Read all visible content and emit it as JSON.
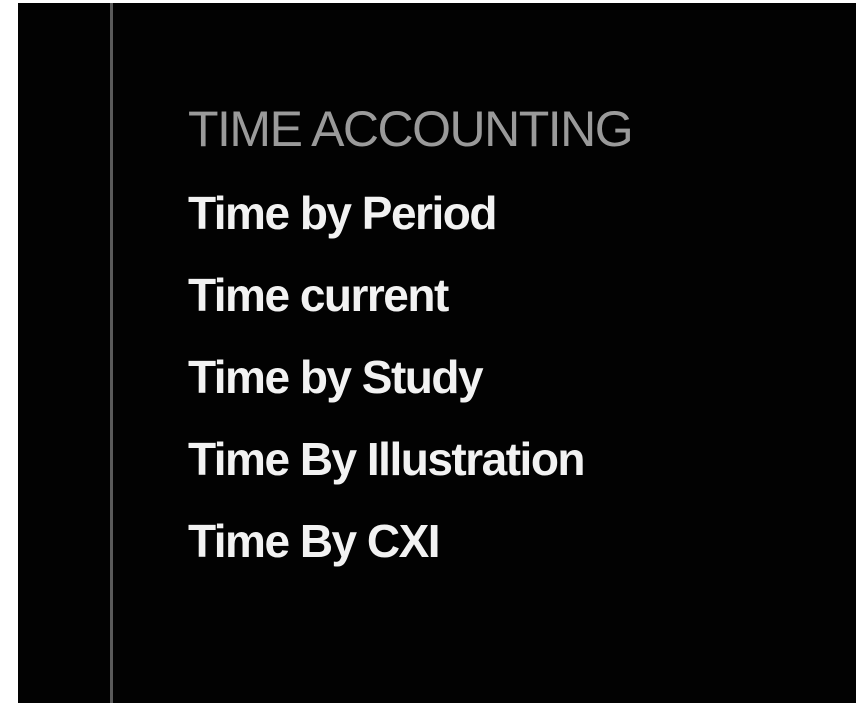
{
  "section": {
    "title": "TIME ACCOUNTING",
    "items": [
      {
        "label": "Time by Period"
      },
      {
        "label": "Time current"
      },
      {
        "label": "Time by Study"
      },
      {
        "label": "Time By Illustration"
      },
      {
        "label": "Time By CXI"
      }
    ]
  },
  "colors": {
    "background": "#020202",
    "title": "#9a9a9a",
    "item_text": "#f2f2f2",
    "divider": "#5a5a5a"
  }
}
